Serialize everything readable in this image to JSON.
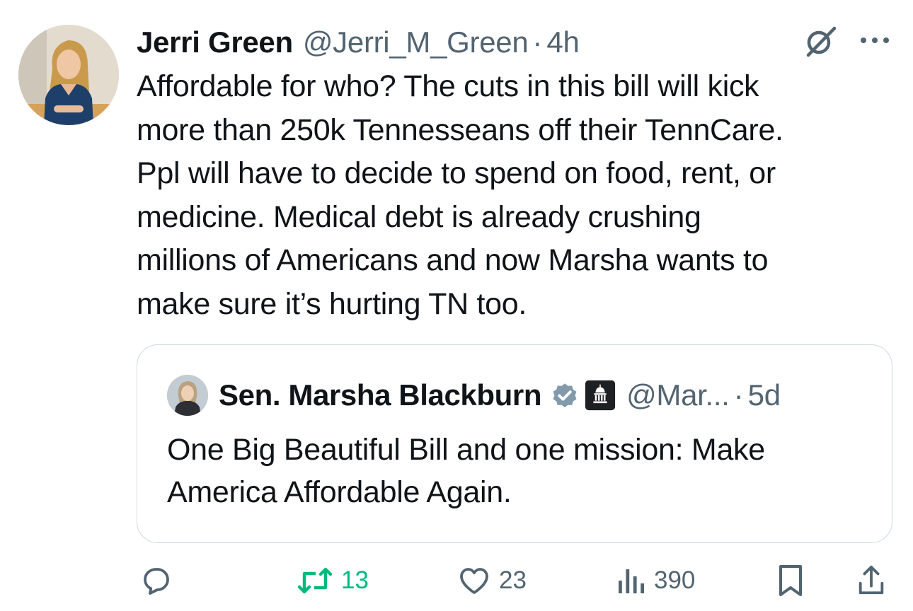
{
  "author": {
    "display_name": "Jerri Green",
    "handle": "@Jerri_M_Green",
    "separator": "·",
    "time": "4h"
  },
  "tweet": {
    "text": "Affordable for who? The cuts in this bill will kick\nmore than 250k Tennesseans off their TennCare.\nPpl will have to decide to spend on food, rent, or\nmedicine. Medical debt is already crushing\nmillions of Americans and now Marsha wants to\nmake sure it’s hurting TN too."
  },
  "quoted_tweet": {
    "display_name": "Sen. Marsha Blackburn",
    "handle": "@Mar...",
    "separator": "·",
    "time": "5d",
    "text": "One Big Beautiful Bill and one mission: Make\nAmerica Affordable Again.",
    "badges": [
      "verified-badge-icon",
      "government-affiliation-icon"
    ]
  },
  "actions": {
    "reply_count": "",
    "retweet_count": "13",
    "like_count": "23",
    "views_count": "390"
  },
  "icons": {
    "grok": "grok-icon",
    "more": "more-options-icon",
    "reply": "reply-icon",
    "retweet": "retweet-icon",
    "like": "heart-icon",
    "views": "views-icon",
    "bookmark": "bookmark-icon",
    "share": "share-icon"
  },
  "colors": {
    "text": "#0f1419",
    "secondary": "#536471",
    "retweet_active": "#00ba7c",
    "verified_badge": "#829aab",
    "border": "#cfd9de"
  }
}
